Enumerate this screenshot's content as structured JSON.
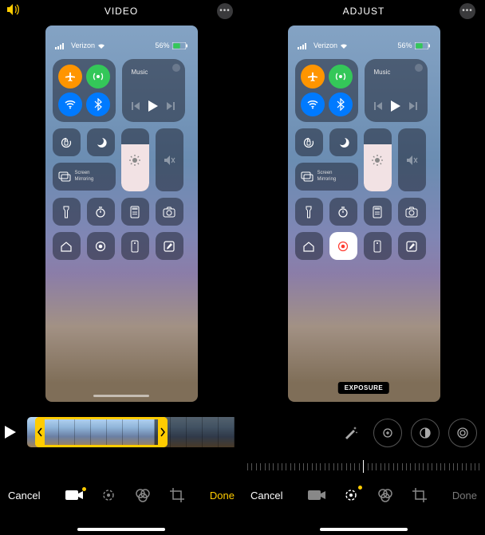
{
  "left": {
    "title": "VIDEO",
    "status": {
      "carrier": "Verizon",
      "battery": "56%"
    },
    "cc": {
      "music_label": "Music",
      "screen_mirroring": "Screen\nMirroring"
    },
    "bottom": {
      "cancel": "Cancel",
      "done": "Done"
    }
  },
  "right": {
    "title": "ADJUST",
    "status": {
      "carrier": "Verizon",
      "battery": "56%"
    },
    "cc": {
      "music_label": "Music",
      "screen_mirroring": "Screen\nMirroring"
    },
    "exposure_label": "EXPOSURE",
    "bottom": {
      "cancel": "Cancel",
      "done": "Done"
    }
  }
}
